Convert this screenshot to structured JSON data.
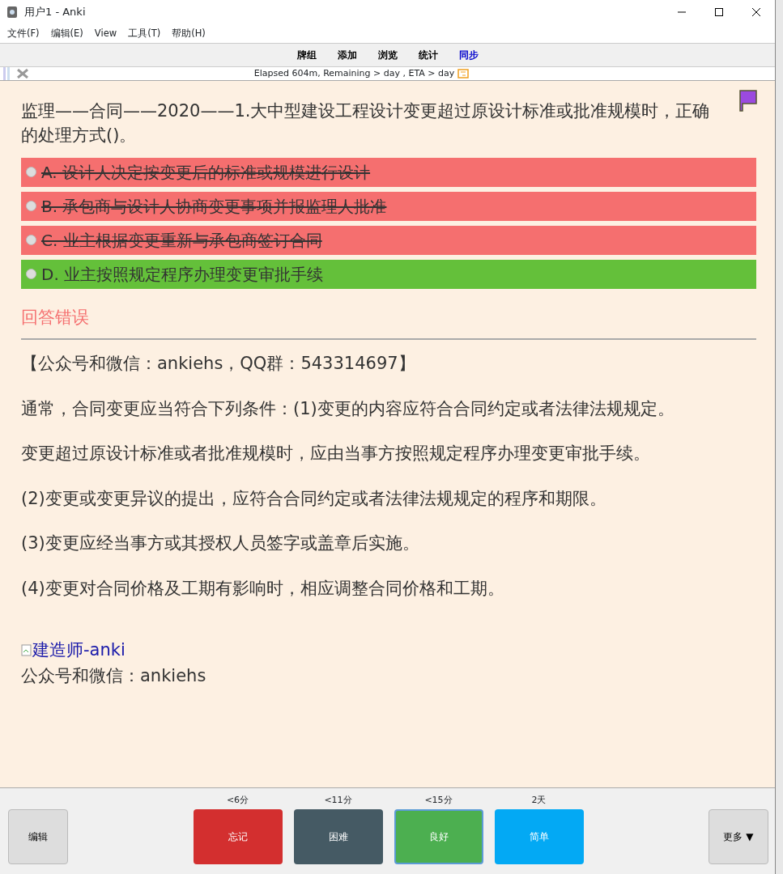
{
  "window": {
    "title": "用户1 - Anki"
  },
  "menu": [
    "文件(F)",
    "编辑(E)",
    "View",
    "工具(T)",
    "帮助(H)"
  ],
  "toolbar": [
    {
      "label": "牌组",
      "selected": false
    },
    {
      "label": "添加",
      "selected": false
    },
    {
      "label": "浏览",
      "selected": false
    },
    {
      "label": "统计",
      "selected": false
    },
    {
      "label": "同步",
      "selected": true
    }
  ],
  "progress": {
    "text": "Elapsed 604m, Remaining > day , ETA > day"
  },
  "card": {
    "question": "监理——合同——2020——1.大中型建设工程设计变更超过原设计标准或批准规模时，正确的处理方式()。",
    "flagged": true,
    "options": [
      {
        "label": "A. 设计人决定按变更后的标准或规模进行设计",
        "kind": "wrong"
      },
      {
        "label": "B. 承包商与设计人协商变更事项并报监理人批准",
        "kind": "wrong"
      },
      {
        "label": "C. 业主根据变更重新与承包商签订合同",
        "kind": "wrong"
      },
      {
        "label": "D. 业主按照规定程序办理变更审批手续",
        "kind": "correct"
      }
    ],
    "result": "回答错误",
    "paragraphs": [
      "【公众号和微信：ankiehs，QQ群：543314697】",
      "通常，合同变更应当符合下列条件：(1)变更的内容应符合合同约定或者法律法规规定。",
      "变更超过原设计标准或者批准规模时，应由当事方按照规定程序办理变更审批手续。",
      "(2)变更或变更异议的提出，应符合合同约定或者法律法规规定的程序和期限。",
      "(3)变更应经当事方或其授权人员签字或盖章后实施。",
      "(4)变更对合同价格及工期有影响时，相应调整合同价格和工期。"
    ],
    "image_alt": "建造师-anki",
    "footer": "公众号和微信：ankiehs"
  },
  "bottom": {
    "edit": "编辑",
    "more": "更多 ▼",
    "answers": [
      {
        "time": "<6分",
        "label": "忘记",
        "color": "#d32f2f",
        "selected": false
      },
      {
        "time": "<11分",
        "label": "困难",
        "color": "#455a64",
        "selected": false
      },
      {
        "time": "<15分",
        "label": "良好",
        "color": "#4caf50",
        "selected": true
      },
      {
        "time": "2天",
        "label": "简单",
        "color": "#03a9f4",
        "selected": false
      }
    ]
  }
}
